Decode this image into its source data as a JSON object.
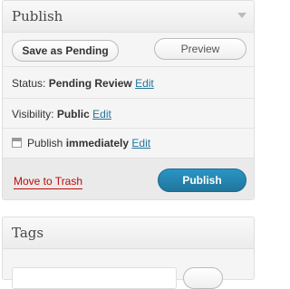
{
  "publish_box": {
    "title": "Publish",
    "save_as_pending_label": "Save as Pending",
    "preview_label": "Preview",
    "status": {
      "label": "Status:",
      "value": "Pending Review",
      "edit": "Edit"
    },
    "visibility": {
      "label": "Visibility:",
      "value": "Public",
      "edit": "Edit"
    },
    "schedule": {
      "label": "Publish",
      "value": "immediately",
      "edit": "Edit"
    },
    "move_to_trash_label": "Move to Trash",
    "publish_label": "Publish"
  },
  "tags_box": {
    "title": "Tags"
  },
  "colors": {
    "link": "#21759b",
    "trash": "#bc0b0b",
    "publish_button": "#21759b"
  },
  "icons": {
    "schedule": "calendar-icon",
    "toggle": "chevron-down-icon"
  }
}
